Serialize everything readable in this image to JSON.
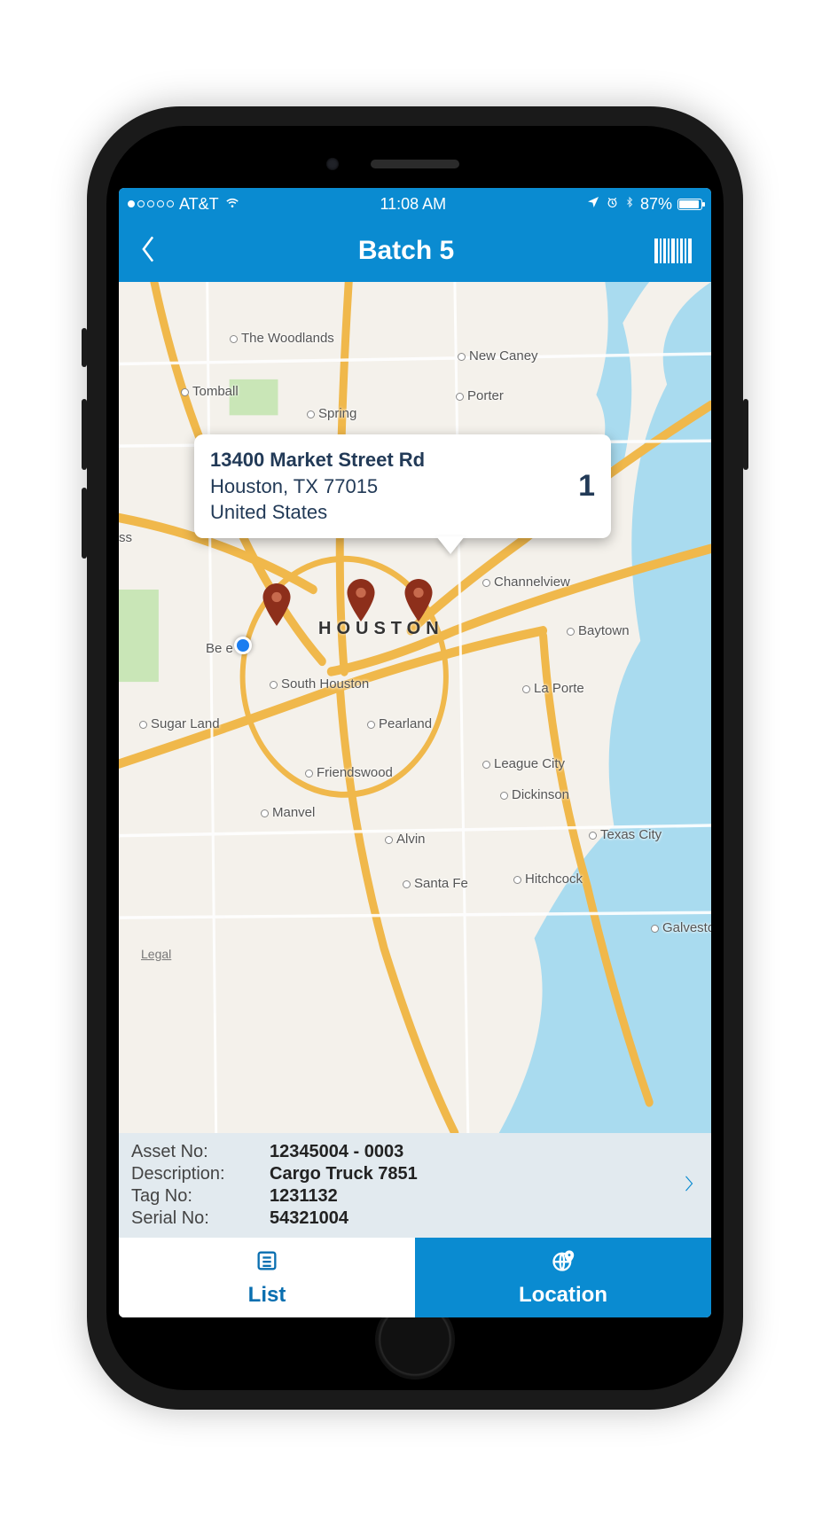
{
  "status_bar": {
    "carrier": "AT&T",
    "time": "11:08 AM",
    "battery_pct": "87%"
  },
  "nav": {
    "title": "Batch 5"
  },
  "map": {
    "callout": {
      "line1": "13400 Market Street Rd",
      "line2": "Houston, TX  77015",
      "line3": "United States",
      "count": "1"
    },
    "houston_label": "HOUSTON",
    "cities": {
      "the_woodlands": "The Woodlands",
      "tomball": "Tomball",
      "spring": "Spring",
      "new_caney": "New Caney",
      "porter": "Porter",
      "channelview": "Channelview",
      "baytown": "Baytown",
      "la_porte": "La Porte",
      "south_houston": "South Houston",
      "sugar_land": "Sugar Land",
      "pearland": "Pearland",
      "friendswood": "Friendswood",
      "manvel": "Manvel",
      "alvin": "Alvin",
      "league_city": "League City",
      "dickinson": "Dickinson",
      "santa_fe": "Santa Fe",
      "texas_city": "Texas City",
      "hitchcock": "Hitchcock",
      "galveston": "Galvesto",
      "bellaire_fragment": "Be      e",
      "ss_fragment": "ss"
    },
    "legal": "Legal"
  },
  "asset": {
    "labels": {
      "asset_no": "Asset No:",
      "description": "Description:",
      "tag_no": "Tag No:",
      "serial_no": "Serial No:"
    },
    "asset_no": "12345004 - 0003",
    "description": "Cargo Truck 7851",
    "tag_no": "1231132",
    "serial_no": "54321004"
  },
  "tabs": {
    "list": "List",
    "location": "Location"
  }
}
